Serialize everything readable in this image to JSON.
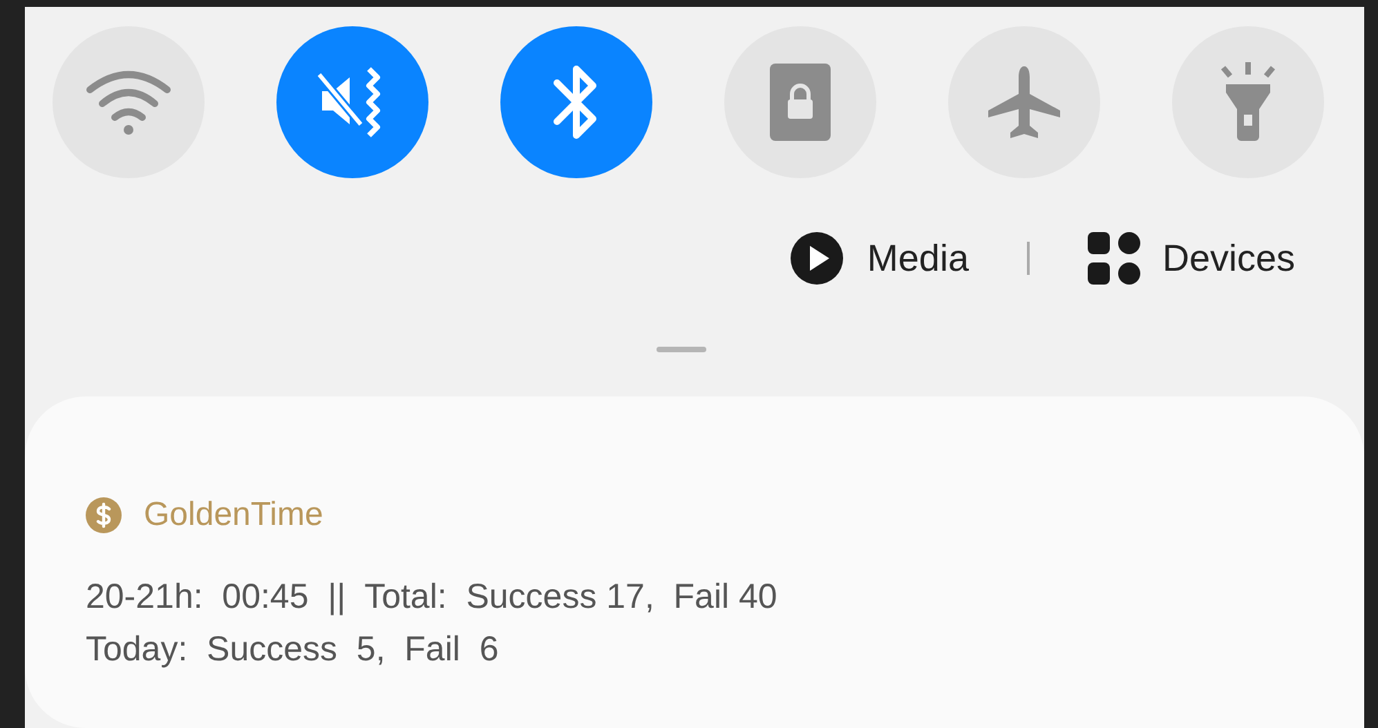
{
  "quick_toggles": [
    {
      "kind": "wifi",
      "on": false
    },
    {
      "kind": "mute",
      "on": true
    },
    {
      "kind": "bluetooth",
      "on": true
    },
    {
      "kind": "lock",
      "on": false
    },
    {
      "kind": "airplane",
      "on": false
    },
    {
      "kind": "flashlight",
      "on": false
    }
  ],
  "media_row": {
    "media": "Media",
    "devices": "Devices"
  },
  "notification": {
    "app_name": "GoldenTime",
    "lines": [
      "20-21h:  00:45  ||  Total:  Success 17,  Fail 40",
      "Today:  Success  5,  Fail  6"
    ]
  }
}
